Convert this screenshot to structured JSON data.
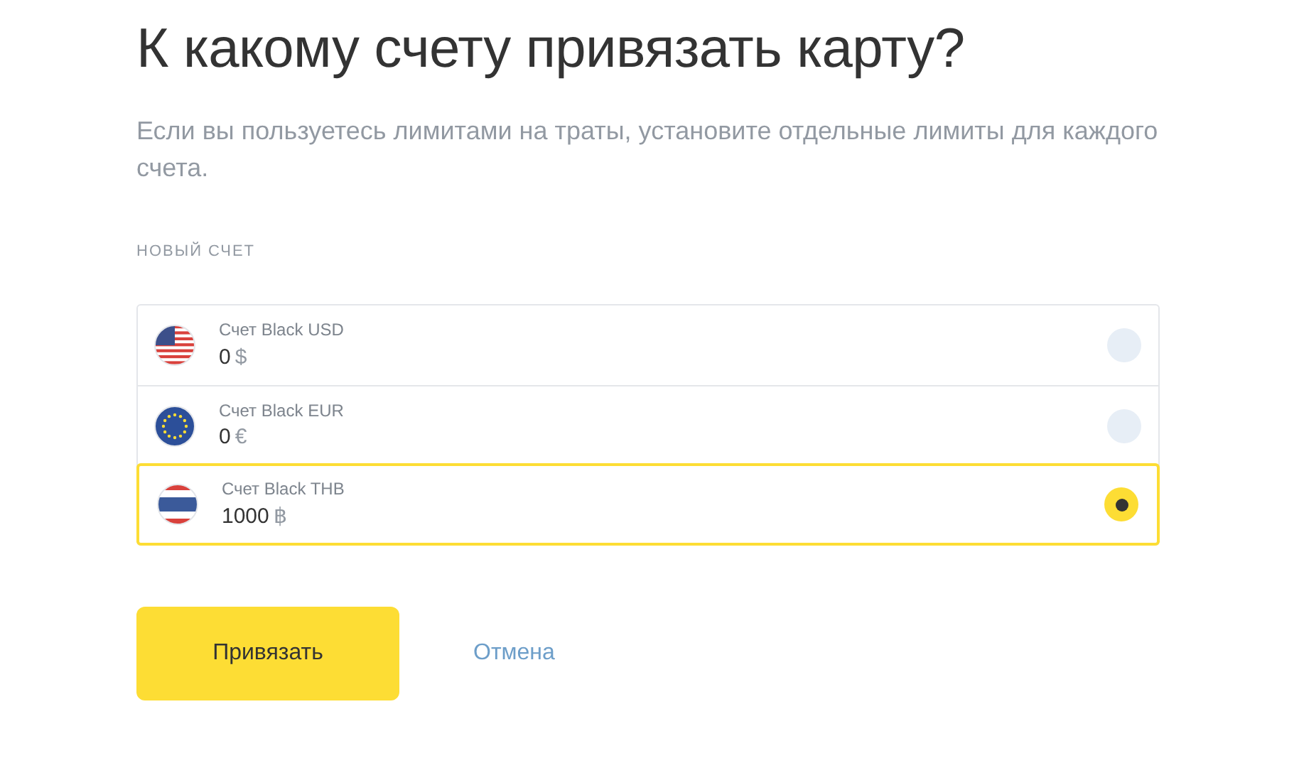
{
  "title": "К какому счету привязать карту?",
  "description": "Если вы пользуетесь лимитами на траты, установите отдельные лимиты для каждого счета.",
  "section_label": "НОВЫЙ СЧЕТ",
  "accounts": [
    {
      "kind": "usd",
      "name": "Счет Black USD",
      "amount": "0",
      "currency": "$",
      "selected": false
    },
    {
      "kind": "eur",
      "name": "Счет Black EUR",
      "amount": "0",
      "currency": "€",
      "selected": false
    },
    {
      "kind": "thb",
      "name": "Счет Black THB",
      "amount": "1000",
      "currency": "฿",
      "selected": true
    }
  ],
  "buttons": {
    "primary": "Привязать",
    "secondary": "Отмена"
  }
}
